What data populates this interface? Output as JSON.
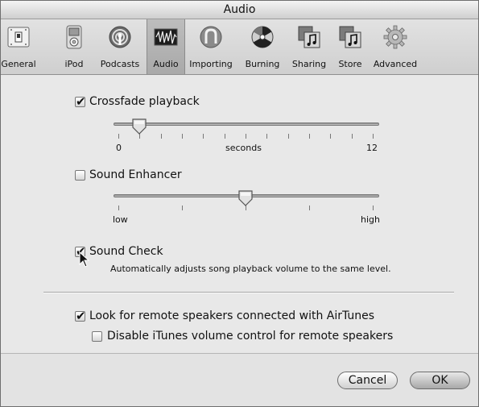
{
  "window": {
    "title": "Audio"
  },
  "toolbar": {
    "items": [
      {
        "label": "General",
        "icon": "general-switch-icon",
        "selected": false
      },
      {
        "label": "iPod",
        "icon": "ipod-icon",
        "selected": false
      },
      {
        "label": "Podcasts",
        "icon": "podcast-icon",
        "selected": false
      },
      {
        "label": "Audio",
        "icon": "audio-waveform-icon",
        "selected": true
      },
      {
        "label": "Importing",
        "icon": "importing-icon",
        "selected": false
      },
      {
        "label": "Burning",
        "icon": "burning-icon",
        "selected": false
      },
      {
        "label": "Sharing",
        "icon": "sharing-music-icon",
        "selected": false
      },
      {
        "label": "Store",
        "icon": "store-music-icon",
        "selected": false
      },
      {
        "label": "Advanced",
        "icon": "gear-icon",
        "selected": false
      }
    ]
  },
  "crossfade": {
    "label": "Crossfade playback",
    "checked": true,
    "slider_min_label": "0",
    "slider_mid_label": "seconds",
    "slider_max_label": "12",
    "value_seconds": 1
  },
  "sound_enhancer": {
    "label": "Sound Enhancer",
    "checked": false,
    "slider_min_label": "low",
    "slider_max_label": "high",
    "value_fraction": 0.5
  },
  "sound_check": {
    "label": "Sound Check",
    "checked": true,
    "description": "Automatically adjusts song playback volume to the same level."
  },
  "airtunes": {
    "label": "Look for remote speakers connected with AirTunes",
    "checked": true,
    "disable_volume_label": "Disable iTunes volume control for remote speakers",
    "disable_volume_checked": false
  },
  "buttons": {
    "cancel_label": "Cancel",
    "ok_label": "OK"
  },
  "colors": {
    "window_bg": "#e8e8e8",
    "toolbar_selected": "#b3b3b3"
  }
}
